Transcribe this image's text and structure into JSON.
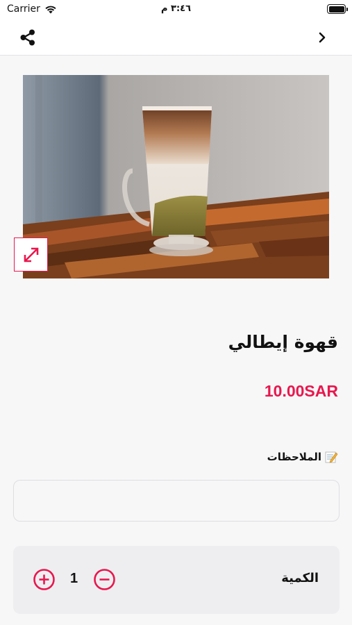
{
  "status_bar": {
    "carrier": "Carrier",
    "time": "٣:٤٦ م"
  },
  "nav": {
    "share_icon": "share-icon",
    "back_icon": "chevron-right-icon"
  },
  "product": {
    "image_description_icon": "coffee-photo",
    "expand_icon": "expand-arrows-icon",
    "name": "قهوة إيطالي",
    "price": "10.00SAR"
  },
  "notes": {
    "label": "الملاحظات",
    "icon": "memo-icon",
    "value": "",
    "placeholder": ""
  },
  "quantity": {
    "label": "الكمية",
    "value": "1",
    "plus_icon": "plus-circle-icon",
    "minus_icon": "minus-circle-icon"
  },
  "colors": {
    "accent": "#e8174d",
    "background": "#f7f7f8",
    "panel": "#eeeef1"
  }
}
